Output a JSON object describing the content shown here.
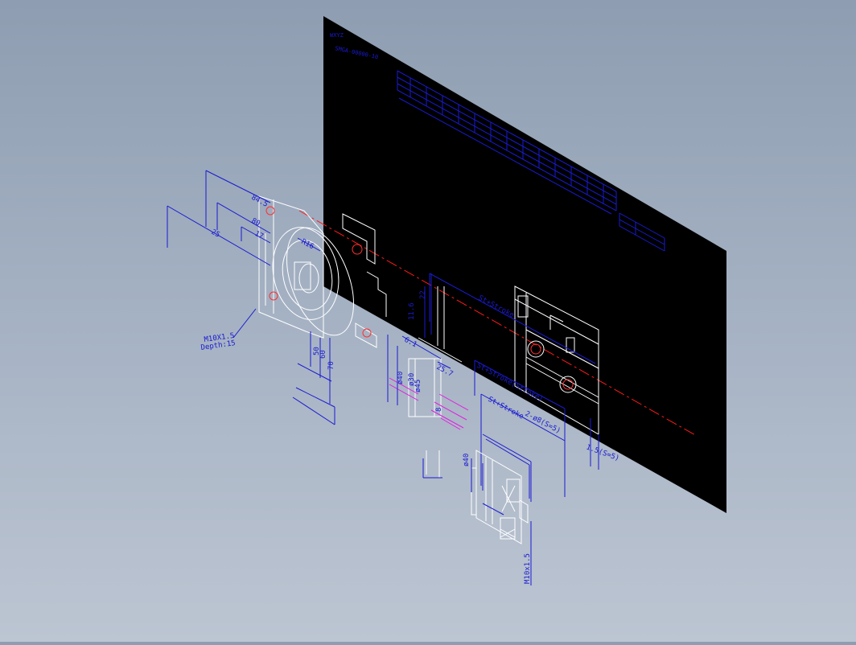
{
  "drawing": {
    "colors": {
      "background_top": "#8e9db1",
      "background_bottom": "#bcc5d2",
      "sheet": "#000000",
      "dimension": "#1a1ad0",
      "geometry": "#ffffff",
      "centerline": "#ff1a1a",
      "hatch": "#e020e0"
    },
    "labels": {
      "dim_84_5": "84.5",
      "dim_80": "80",
      "dim_25": "25",
      "dim_17": "17",
      "dim_r16": "R16",
      "dim_50": "50",
      "dim_60": "60",
      "dim_70": "70",
      "thread_callout_1": "M10X1.5",
      "thread_callout_2": "Depth:15",
      "dim_d40": "ø40",
      "dim_d30": "ø30",
      "dim_d45": "ø45",
      "dim_25_7": "25.7",
      "dim_6_1": "6.1",
      "dim_11_6": "11.6",
      "dim_22": "22",
      "dim_8": "8",
      "stroke_1": "St+Stroke",
      "stroke_2": "St+Stroke(Stroke)",
      "stroke_3": "St+Stroke",
      "dim_dia40": "ø40",
      "dim_m10": "M10x1.5",
      "dim_1_5": "1.5(S=5)",
      "dim_2_0": "2-ø8(S=5)",
      "sheet_title_1": "WXYZ",
      "sheet_title_2": "SMGA-00000-10"
    }
  }
}
